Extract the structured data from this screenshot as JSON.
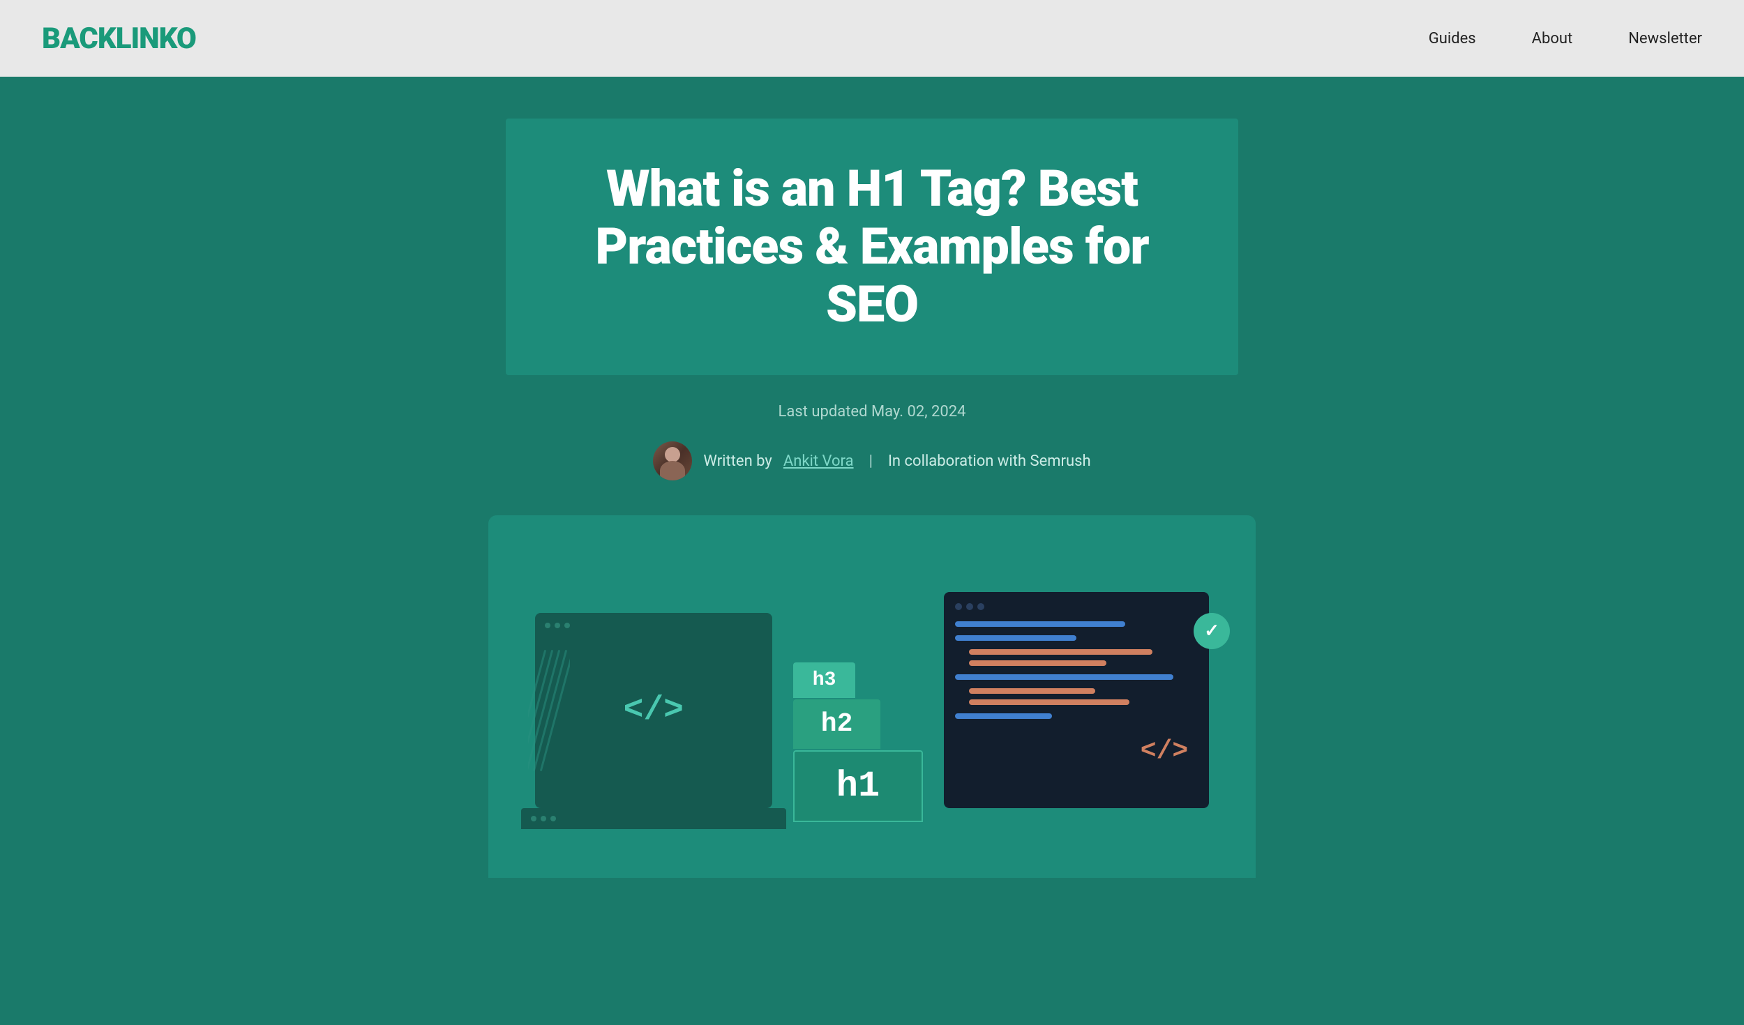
{
  "header": {
    "logo": "BACKLINKO",
    "nav": {
      "guides": "Guides",
      "about": "About",
      "newsletter": "Newsletter"
    }
  },
  "hero": {
    "title": "What is an H1 Tag? Best Practices & Examples for SEO",
    "last_updated_label": "Last updated May. 02, 2024",
    "written_by_label": "Written by",
    "author_name": "Ankit Vora",
    "collaboration_label": "In collaboration with Semrush"
  },
  "illustration": {
    "left_tag": "</>",
    "right_tag": "</>",
    "h3_label": "h3",
    "h2_label": "h2",
    "h1_label": "h1"
  }
}
